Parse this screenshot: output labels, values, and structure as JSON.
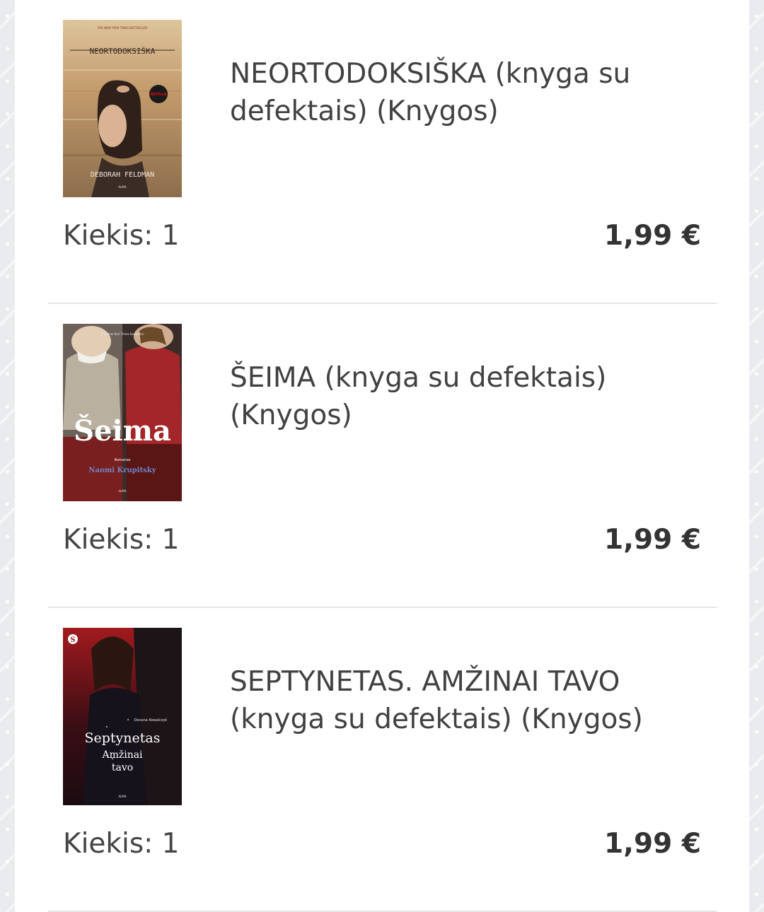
{
  "cart_items": [
    {
      "title": "NEORTODOKSIŠKA (knyga su defektais) (Knygos)",
      "quantity_text": "Kiekis: 1",
      "price": "1,99 €",
      "cover": {
        "top_line": "THE NEW YORK TIMES BESTSELLER",
        "title": "NEORTODOKSIŠKA",
        "author": "DEBORAH FELDMAN",
        "badge": "NETFLIX",
        "publisher": "ALMA"
      }
    },
    {
      "title": "ŠEIMA (knyga su defektais) (Knygos)",
      "quantity_text": "Kiekis: 1",
      "price": "1,99 €",
      "cover": {
        "top_line": "The New York Times bestseller",
        "title": "Šeima",
        "genre": "Romanas",
        "author": "Naomi Krupitsky",
        "publisher": "ALMA"
      }
    },
    {
      "title": "SEPTYNETAS. AMŽINAI TAVO (knyga su defektais) (Knygos)",
      "quantity_text": "Kiekis: 1",
      "price": "1,99 €",
      "cover": {
        "badge": "S",
        "author": "Dovana Kowalczyk",
        "title_line1": "Septynetas",
        "title_line2": "Amžinai",
        "title_line3": "tavo",
        "publisher": "ALMA"
      }
    }
  ]
}
